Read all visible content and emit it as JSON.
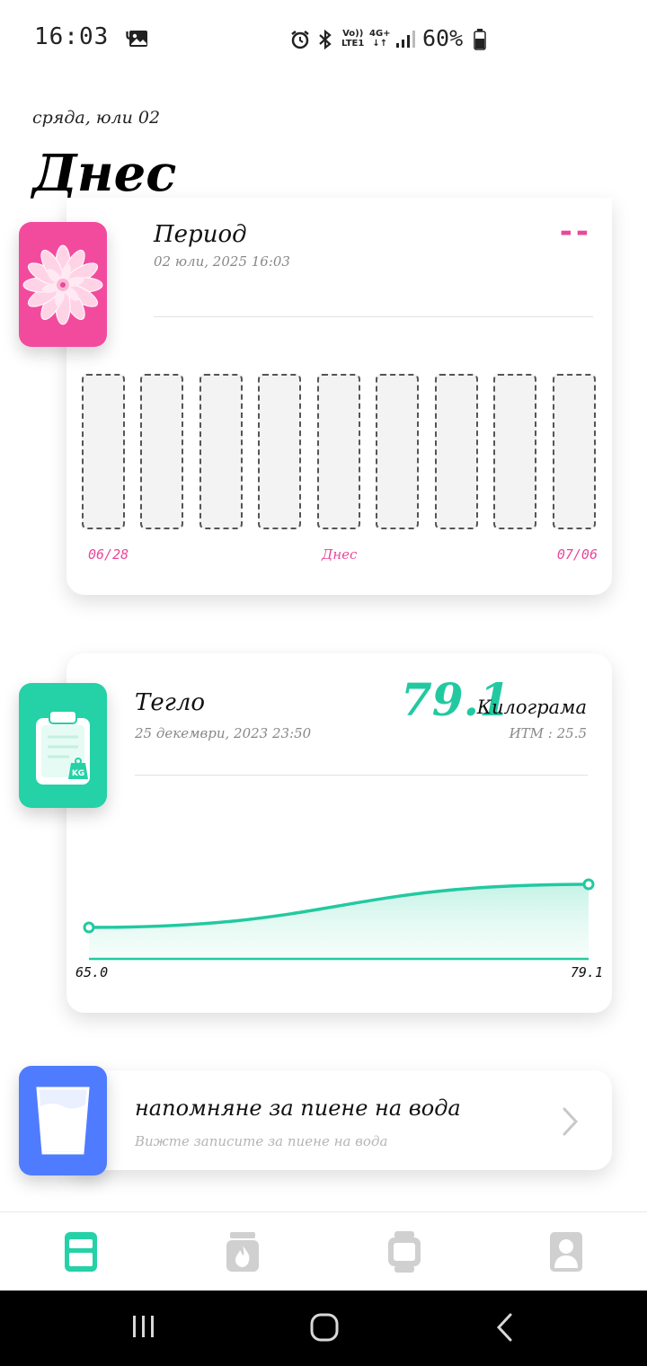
{
  "status_bar": {
    "time": "16:03 ч.",
    "network_top": "Vo))",
    "network_bottom": "LTE1",
    "data_type": "4G+",
    "battery": "60%"
  },
  "header": {
    "date": "сряда, юли 02",
    "title": "Днес"
  },
  "period_card": {
    "title": "Период",
    "timestamp": "02 юли, 2025 16:03",
    "value": "--",
    "axis_start": "06/28",
    "axis_middle": "Днес",
    "axis_end": "07/06",
    "accent_color": "#e8489a",
    "badge_color": "#f24b9e",
    "icon": "flower-icon",
    "bars": [
      0,
      0,
      0,
      0,
      0,
      0,
      0,
      0,
      0
    ]
  },
  "weight_card": {
    "title": "Тегло",
    "timestamp": "25 декември, 2023 23:50",
    "value": "79.1",
    "unit": "Килограма",
    "bmi": "ИТМ : 25.5",
    "accent_color": "#22c9a0",
    "badge_color": "#25d1a6",
    "icon": "clipboard-kg-icon",
    "kg_tag": "KG"
  },
  "water_card": {
    "title": "напомняне за пиене на вода",
    "subtitle": "Вижте записите за пиене на вода",
    "badge_color": "#4f7cff",
    "icon": "water-glass-icon"
  },
  "chart_data": {
    "type": "line",
    "x": [
      "start",
      "end"
    ],
    "series": [
      {
        "values": [
          65.0,
          79.1
        ]
      }
    ],
    "tick_labels": [
      "65.0",
      "79.1"
    ]
  },
  "bottom_nav": {
    "items": [
      "home-icon",
      "calories-icon",
      "watch-icon",
      "profile-icon"
    ],
    "active_color": "#25d1a6",
    "inactive_color": "#d0d0d0"
  }
}
